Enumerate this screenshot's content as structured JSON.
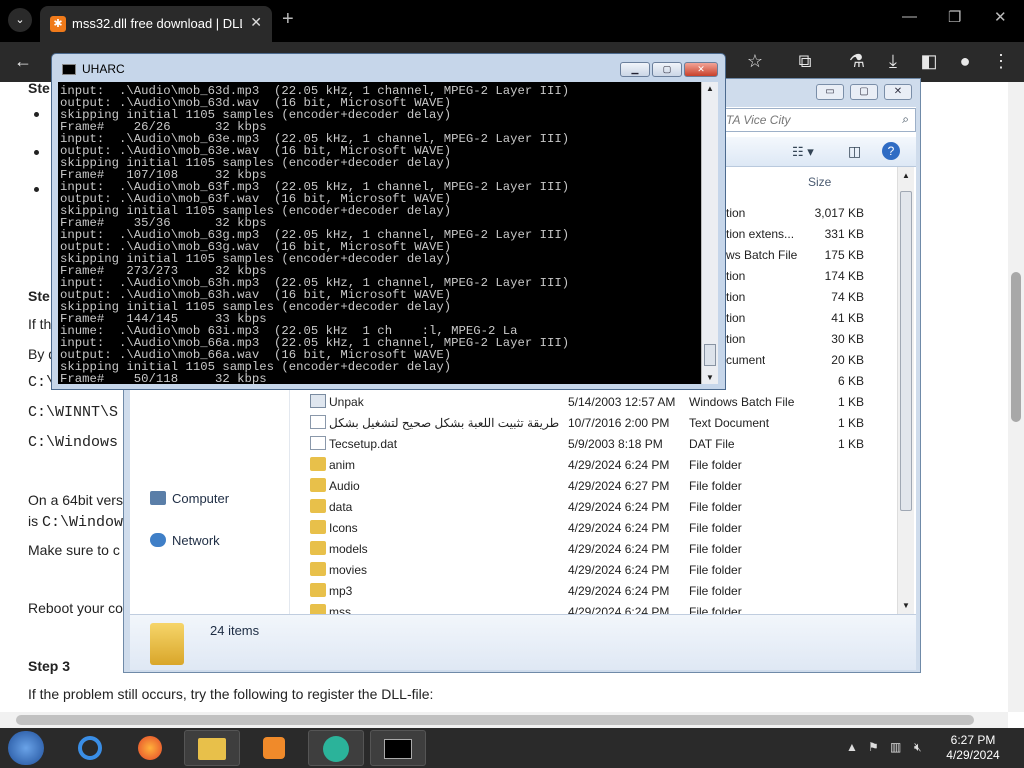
{
  "browser": {
    "tab_title": "mss32.dll free download | DLL-",
    "favicon": "gear-icon",
    "accent": "#f07a1a"
  },
  "webpage": {
    "step_partial_1": "Ste",
    "step_partial_2": "Ste",
    "text_if": "If th",
    "text_by": "By d",
    "path_c1": "C:\\",
    "path_c2": "C:\\WINNT\\S",
    "path_c3": "C:\\Windows",
    "text_64bit_a": "On a 64bit vers",
    "text_64bit_b_prefix": "is ",
    "text_64bit_b_mono": "C:\\Window",
    "text_make_sure": "Make sure to c",
    "text_reboot": "Reboot your co",
    "step3": "Step 3",
    "step3_text": "If the problem still occurs, try the following to register the DLL-file:"
  },
  "explorer": {
    "search_placeholder": "TA Vice City",
    "col_size": "Size",
    "nav": {
      "computer": "Computer",
      "network": "Network"
    },
    "hidden_rows": [
      {
        "type": "tion",
        "size": "3,017 KB"
      },
      {
        "type": "tion extens...",
        "size": "331 KB"
      },
      {
        "type": "ws Batch File",
        "size": "175 KB"
      },
      {
        "type": "tion",
        "size": "174 KB"
      },
      {
        "type": "tion",
        "size": "74 KB"
      },
      {
        "type": "tion",
        "size": "41 KB"
      },
      {
        "type": "tion",
        "size": "30 KB"
      },
      {
        "type": "cument",
        "size": "20 KB"
      },
      {
        "type": "",
        "size": "6 KB"
      }
    ],
    "rows": [
      {
        "name": "Unpak",
        "date": "5/14/2003 12:57 AM",
        "type": "Windows Batch File",
        "size": "1 KB",
        "icon": "bat"
      },
      {
        "name": "طريقة تثبيت اللعبة بشكل صحيح لتشغيل بشكل ...",
        "date": "10/7/2016 2:00 PM",
        "type": "Text Document",
        "size": "1 KB",
        "icon": "doc"
      },
      {
        "name": "Tecsetup.dat",
        "date": "5/9/2003 8:18 PM",
        "type": "DAT File",
        "size": "1 KB",
        "icon": "doc"
      },
      {
        "name": "anim",
        "date": "4/29/2024 6:24 PM",
        "type": "File folder",
        "size": "",
        "icon": "folder"
      },
      {
        "name": "Audio",
        "date": "4/29/2024 6:27 PM",
        "type": "File folder",
        "size": "",
        "icon": "folder"
      },
      {
        "name": "data",
        "date": "4/29/2024 6:24 PM",
        "type": "File folder",
        "size": "",
        "icon": "folder"
      },
      {
        "name": "Icons",
        "date": "4/29/2024 6:24 PM",
        "type": "File folder",
        "size": "",
        "icon": "folder"
      },
      {
        "name": "models",
        "date": "4/29/2024 6:24 PM",
        "type": "File folder",
        "size": "",
        "icon": "folder"
      },
      {
        "name": "movies",
        "date": "4/29/2024 6:24 PM",
        "type": "File folder",
        "size": "",
        "icon": "folder"
      },
      {
        "name": "mp3",
        "date": "4/29/2024 6:24 PM",
        "type": "File folder",
        "size": "",
        "icon": "folder"
      },
      {
        "name": "mss",
        "date": "4/29/2024 6:24 PM",
        "type": "File folder",
        "size": "",
        "icon": "folder"
      }
    ],
    "item_count": "24 items"
  },
  "console": {
    "title": "UHARC",
    "lines": [
      "input:  .\\Audio\\mob_63d.mp3  (22.05 kHz, 1 channel, MPEG-2 Layer III)",
      "output: .\\Audio\\mob_63d.wav  (16 bit, Microsoft WAVE)",
      "skipping initial 1105 samples (encoder+decoder delay)",
      "Frame#    26/26      32 kbps",
      "input:  .\\Audio\\mob_63e.mp3  (22.05 kHz, 1 channel, MPEG-2 Layer III)",
      "output: .\\Audio\\mob_63e.wav  (16 bit, Microsoft WAVE)",
      "skipping initial 1105 samples (encoder+decoder delay)",
      "Frame#   107/108     32 kbps",
      "input:  .\\Audio\\mob_63f.mp3  (22.05 kHz, 1 channel, MPEG-2 Layer III)",
      "output: .\\Audio\\mob_63f.wav  (16 bit, Microsoft WAVE)",
      "skipping initial 1105 samples (encoder+decoder delay)",
      "Frame#    35/36      32 kbps",
      "input:  .\\Audio\\mob_63g.mp3  (22.05 kHz, 1 channel, MPEG-2 Layer III)",
      "output: .\\Audio\\mob_63g.wav  (16 bit, Microsoft WAVE)",
      "skipping initial 1105 samples (encoder+decoder delay)",
      "Frame#   273/273     32 kbps",
      "input:  .\\Audio\\mob_63h.mp3  (22.05 kHz, 1 channel, MPEG-2 Layer III)",
      "output: .\\Audio\\mob_63h.wav  (16 bit, Microsoft WAVE)",
      "skipping initial 1105 samples (encoder+decoder delay)",
      "Frame#   144/145     33 kbps",
      "inume:  .\\Audio\\mob 63i.mp3  (22.05 kHz  1 ch    :l, MPEG-2 La",
      "input:  .\\Audio\\mob_66a.mp3  (22.05 kHz, 1 channel, MPEG-2 Layer III)",
      "output: .\\Audio\\mob_66a.wav  (16 bit, Microsoft WAVE)",
      "skipping initial 1105 samples (encoder+decoder delay)",
      "Frame#    50/118     32 kbps"
    ]
  },
  "taskbar": {
    "clock_time": "6:27 PM",
    "clock_date": "4/29/2024"
  }
}
